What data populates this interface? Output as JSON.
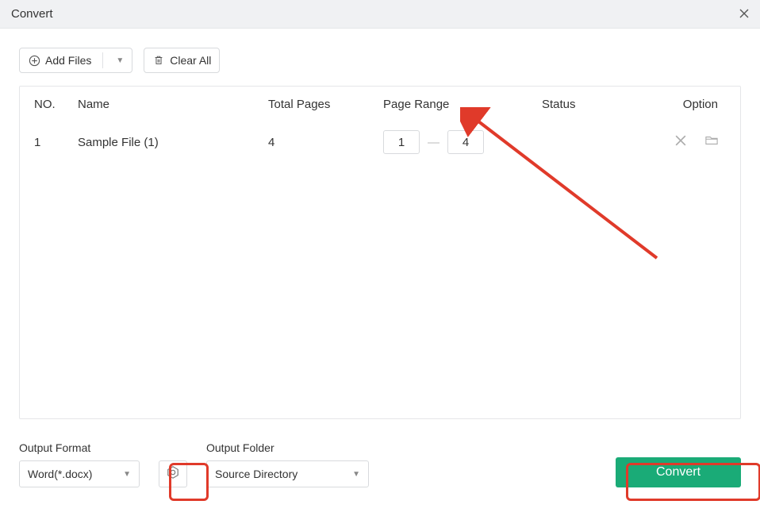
{
  "titlebar": {
    "title": "Convert"
  },
  "toolbar": {
    "add_files_label": "Add Files",
    "clear_all_label": "Clear All"
  },
  "table": {
    "headers": {
      "no": "NO.",
      "name": "Name",
      "total_pages": "Total Pages",
      "page_range": "Page Range",
      "status": "Status",
      "option": "Option"
    },
    "rows": [
      {
        "no": "1",
        "name": "Sample File (1)",
        "total_pages": "4",
        "range_from": "1",
        "range_to": "4",
        "status": ""
      }
    ]
  },
  "footer": {
    "output_format_label": "Output Format",
    "output_format_value": "Word(*.docx)",
    "output_folder_label": "Output Folder",
    "output_folder_value": "Source Directory",
    "convert_label": "Convert"
  }
}
